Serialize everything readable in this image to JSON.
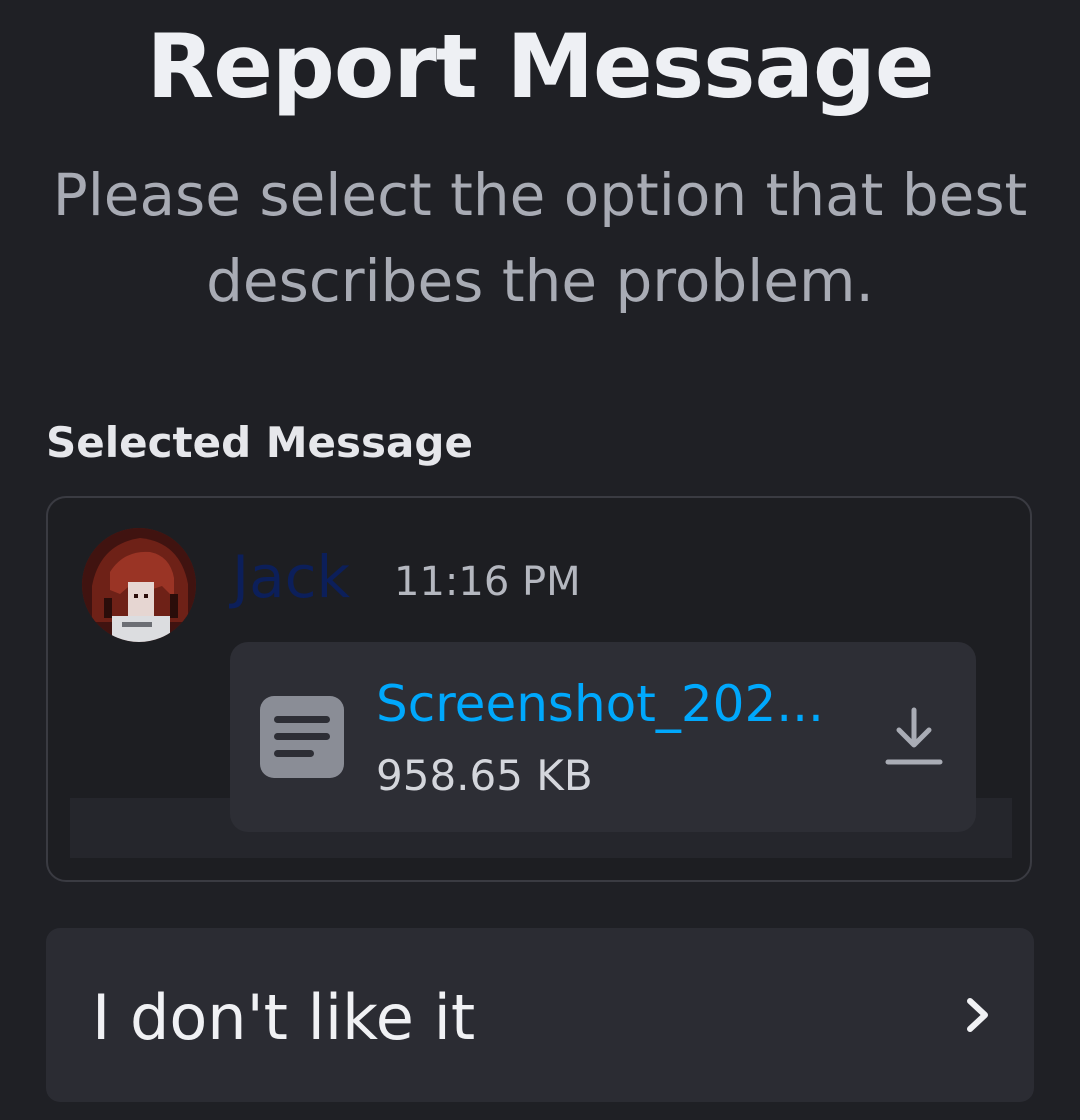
{
  "header": {
    "title": "Report Message",
    "subtitle": "Please select the option that best describes the problem."
  },
  "selected_message": {
    "section_label": "Selected Message",
    "author": {
      "name": "Jack",
      "avatar": "avatar-pixel-character",
      "name_color": "#0c1f5a"
    },
    "timestamp": "11:16 PM",
    "attachment": {
      "file_name": "Screenshot_202...",
      "file_size": "958.65 KB",
      "file_icon": "document-icon",
      "action_icon": "download-icon",
      "link_color": "#00a8fc"
    }
  },
  "options": [
    {
      "label": "I don't like it",
      "icon": "chevron-right-icon"
    }
  ],
  "colors": {
    "background": "#1f2025",
    "card_border": "#3a3b42",
    "attachment_background": "#2d2e35",
    "option_background": "#2b2c33"
  }
}
